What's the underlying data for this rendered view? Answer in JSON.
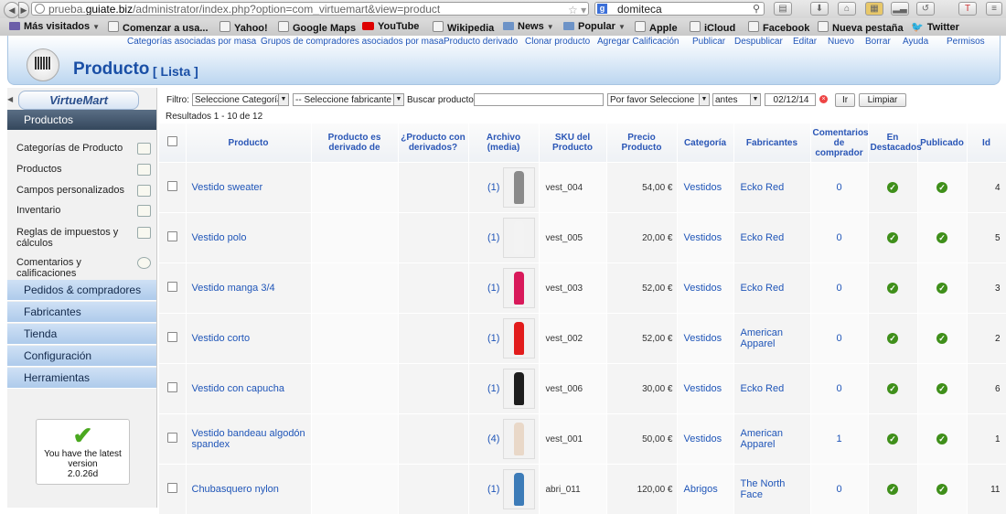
{
  "browser": {
    "url_prefix": "prueba.",
    "url_domain": "guiate.biz",
    "url_path": "/administrator/index.php?option=com_virtuemart&view=product",
    "search_text": "domiteca",
    "search_engine_badge": "g"
  },
  "bookmarks": [
    {
      "label": "Más visitados",
      "kind": "folder",
      "arrow": true
    },
    {
      "label": "Comenzar a usa...",
      "kind": "page"
    },
    {
      "label": "Yahoo!",
      "kind": "page"
    },
    {
      "label": "Google Maps",
      "kind": "page"
    },
    {
      "label": "YouTube",
      "kind": "youtube"
    },
    {
      "label": "Wikipedia",
      "kind": "page"
    },
    {
      "label": "News",
      "kind": "folder",
      "arrow": true
    },
    {
      "label": "Popular",
      "kind": "folder",
      "arrow": true
    },
    {
      "label": "Apple",
      "kind": "page"
    },
    {
      "label": "iCloud",
      "kind": "page"
    },
    {
      "label": "Facebook",
      "kind": "page"
    },
    {
      "label": "Nueva pestaña",
      "kind": "page"
    },
    {
      "label": "Twitter",
      "kind": "twitter"
    }
  ],
  "toplinks": [
    "Categorías asociadas por masa",
    "Grupos de compradores asociados por masa",
    "Producto derivado",
    "Clonar producto",
    "Agregar Calificación",
    "Publicar",
    "Despublicar",
    "Editar",
    "Nuevo",
    "Borrar",
    "Ayuda",
    "Permisos"
  ],
  "header": {
    "title": "Producto",
    "subtitle": "[ Lista ]"
  },
  "sidebar": {
    "logo_text": "VirtueMart",
    "active_section": "Productos",
    "sub_items": [
      "Categorías de Producto",
      "Productos",
      "Campos personalizados",
      "Inventario",
      "Reglas de impuestos y cálculos",
      "Comentarios y calificaciones"
    ],
    "sections": [
      "Pedidos & compradores",
      "Fabricantes",
      "Tienda",
      "Configuración",
      "Herramientas"
    ],
    "version_text": "You have the latest version",
    "version_number": "2.0.26d"
  },
  "filters": {
    "label": "Filtro:",
    "category": "Seleccione Categoría",
    "manufacturer": "-- Seleccione fabricante --",
    "search_label": "Buscar producto",
    "search_value": "",
    "status": "Por favor Seleccione",
    "when": "antes",
    "date": "02/12/14",
    "go_label": "Ir",
    "clear_label": "Limpiar"
  },
  "results_text": "Resultados 1 - 10 de 12",
  "columns": [
    "Producto",
    "Producto es derivado de",
    "¿Producto con derivados?",
    "Archivo (media)",
    "SKU del Producto",
    "Precio Producto",
    "Categoría",
    "Fabricantes",
    "Comentarios de comprador",
    "En Destacados",
    "Publicado",
    "Id"
  ],
  "products": [
    {
      "name": "Vestido sweater",
      "media": "(1)",
      "sku": "vest_004",
      "price": "54,00 €",
      "category": "Vestidos",
      "manufacturer": "Ecko Red",
      "reviews": "0",
      "featured": true,
      "published": true,
      "id": "4",
      "color": "#8a8a8a"
    },
    {
      "name": "Vestido polo",
      "media": "(1)",
      "sku": "vest_005",
      "price": "20,00 €",
      "category": "Vestidos",
      "manufacturer": "Ecko Red",
      "reviews": "0",
      "featured": true,
      "published": true,
      "id": "5",
      "color": "#f3f3f3"
    },
    {
      "name": "Vestido manga 3/4",
      "media": "(1)",
      "sku": "vest_003",
      "price": "52,00 €",
      "category": "Vestidos",
      "manufacturer": "Ecko Red",
      "reviews": "0",
      "featured": true,
      "published": true,
      "id": "3",
      "color": "#d8195a"
    },
    {
      "name": "Vestido corto",
      "media": "(1)",
      "sku": "vest_002",
      "price": "52,00 €",
      "category": "Vestidos",
      "manufacturer": "American Apparel",
      "reviews": "0",
      "featured": true,
      "published": true,
      "id": "2",
      "color": "#e21c1c"
    },
    {
      "name": "Vestido con capucha",
      "media": "(1)",
      "sku": "vest_006",
      "price": "30,00 €",
      "category": "Vestidos",
      "manufacturer": "Ecko Red",
      "reviews": "0",
      "featured": true,
      "published": true,
      "id": "6",
      "color": "#1d1d1d"
    },
    {
      "name": "Vestido bandeau algodón spandex",
      "media": "(4)",
      "sku": "vest_001",
      "price": "50,00 €",
      "category": "Vestidos",
      "manufacturer": "American Apparel",
      "reviews": "1",
      "featured": true,
      "published": true,
      "id": "1",
      "color": "#e9d8c8"
    },
    {
      "name": "Chubasquero nylon",
      "media": "(1)",
      "sku": "abri_011",
      "price": "120,00 €",
      "category": "Abrigos",
      "manufacturer": "The North Face",
      "reviews": "0",
      "featured": true,
      "published": true,
      "id": "11",
      "color": "#3d7cb8"
    }
  ]
}
